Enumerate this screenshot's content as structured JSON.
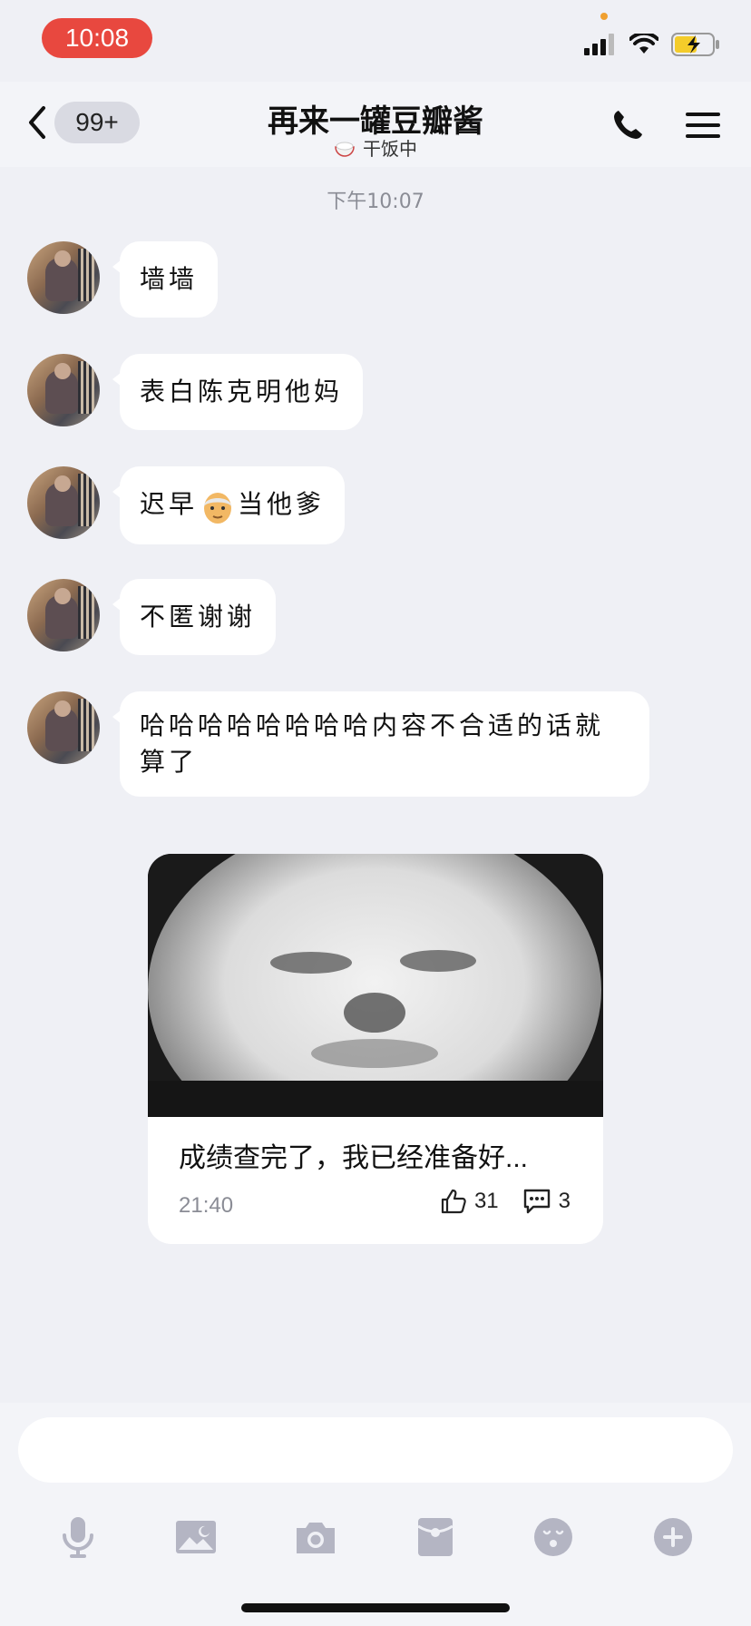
{
  "status": {
    "time": "10:08"
  },
  "nav": {
    "badge": "99+",
    "title": "再来一罐豆瓣酱",
    "status_text": "干饭中"
  },
  "timestamp": "下午10:07",
  "messages": [
    {
      "text": "墙墙"
    },
    {
      "text": "表白陈克明他妈"
    },
    {
      "text_before": "迟早",
      "emoji": "old-man-emoji",
      "text_after": "当他爹"
    },
    {
      "text": "不匿谢谢"
    },
    {
      "text": "哈哈哈哈哈哈哈哈内容不合适的话就算了"
    }
  ],
  "card": {
    "title": "成绩查完了，我已经准备好...",
    "time": "21:40",
    "likes": "31",
    "comments": "3"
  },
  "colors": {
    "background": "#eff0f5",
    "time_pill": "#e8483f",
    "icon": "#b4b5c3"
  }
}
